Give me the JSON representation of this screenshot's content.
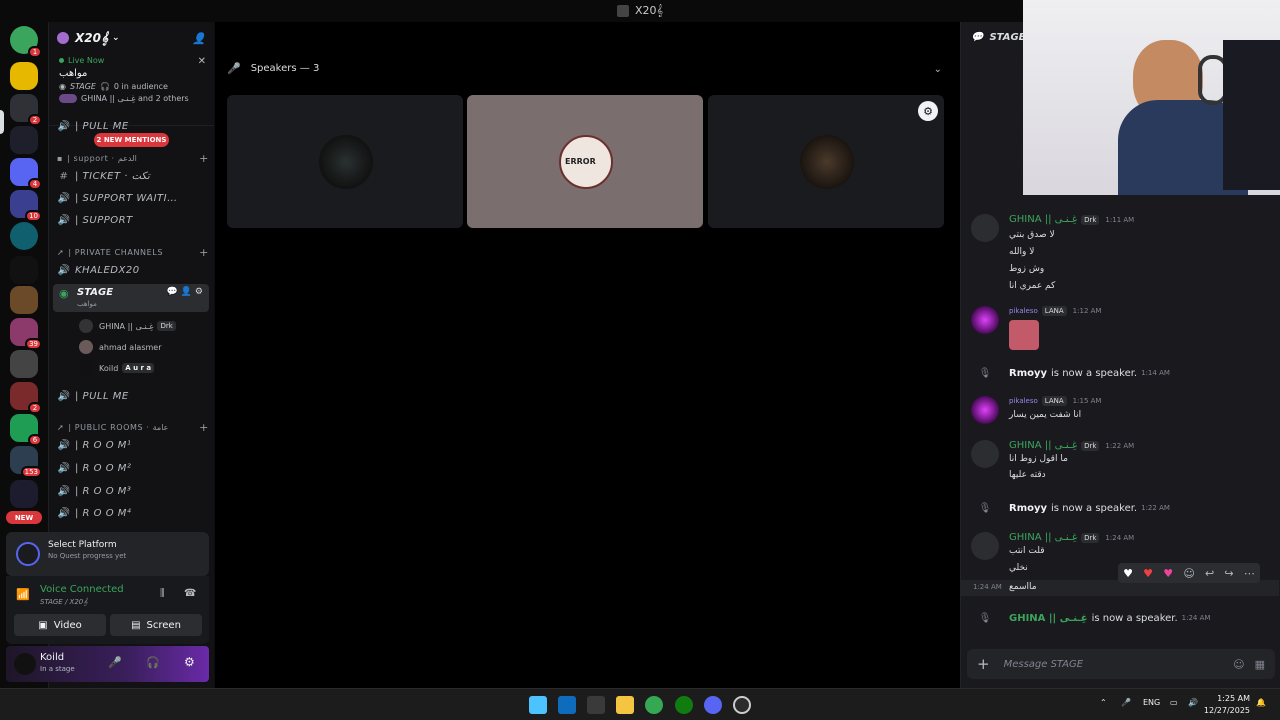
{
  "window": {
    "title": "X20𝄞"
  },
  "colors": {
    "accent": "#5865f2",
    "green": "#3ba55d",
    "red": "#da373c",
    "bg": "#0d0d0e"
  },
  "rail": {
    "badges": [
      "1",
      "2",
      "4",
      "10",
      "39",
      "2",
      "6",
      "153"
    ],
    "new_label": "NEW"
  },
  "guild": {
    "name": "X20𝄞"
  },
  "live": {
    "status": "Live Now",
    "title": "مواهب",
    "stage_label": "STAGE",
    "audience": "0 in audience",
    "speakers": "GHINA || غِـنـى and 2 others"
  },
  "mentions": "2 NEW MENTIONS",
  "channels": {
    "pull_me_top": "| PULL ME",
    "support_cat": "| support · الدعم",
    "ticket": "| TICKET · تكت",
    "support_wait": "| SUPPORT WAITI…",
    "support": "| SUPPORT",
    "private_cat": "| PRIVATE CHANNELS",
    "khaled": "KHALEDX20",
    "stage": "STAGE",
    "stage_sub": "مواهب",
    "members": [
      {
        "name": "GHINA || غِـنـى",
        "tag": "Drk"
      },
      {
        "name": "ahmad alasmer",
        "tag": ""
      },
      {
        "name": "Koild",
        "tag": "A u r a"
      }
    ],
    "pull_me": "| PULL ME",
    "public_cat": "| PUBLIC ROOMS · عامة",
    "rooms": [
      "| R O O M¹",
      "| R O O M²",
      "| R O O M³",
      "| R O O M⁴"
    ]
  },
  "quest": {
    "title": "Select Platform",
    "sub": "No Quest progress yet"
  },
  "voice": {
    "status": "Voice Connected",
    "channel": "STAGE / X20𝄞",
    "video": "Video",
    "screen": "Screen"
  },
  "user": {
    "name": "Koild",
    "status": "In a stage"
  },
  "stage": {
    "speakers_header": "Speakers — 3",
    "tile2_label": "ERROR"
  },
  "chat": {
    "header": "STAGE",
    "m1": {
      "author": "GHINA || غِـنـى",
      "tag": "Drk",
      "time": "1:11 AM",
      "lines": [
        "لا صدق بنتي",
        "لا والله",
        "وش زوط",
        "كم عمري انا"
      ]
    },
    "m2": {
      "author": "pikaleso",
      "tag": "LANA",
      "time": "1:12 AM"
    },
    "s1": {
      "name": "Rmoyy",
      "text": "is now a speaker.",
      "time": "1:14 AM"
    },
    "m3": {
      "author": "pikaleso",
      "tag": "LANA",
      "time": "1:15 AM",
      "line": "انا شفت يمين يسار"
    },
    "m4": {
      "author": "GHINA || غِـنـى",
      "tag": "Drk",
      "time": "1:22 AM",
      "lines": [
        "ما اقول زوط انا",
        "دقته عليها"
      ]
    },
    "s2": {
      "name": "Rmoyy",
      "text": "is now a speaker.",
      "time": "1:22 AM"
    },
    "m5": {
      "author": "GHINA || غِـنـى",
      "tag": "Drk",
      "time": "1:24 AM",
      "lines": [
        "قلت انتب",
        "نخلي"
      ],
      "cont_time": "1:24 AM",
      "cont_line": "مااسمع"
    },
    "s3": {
      "name": "GHINA || غِـنـى",
      "text": "is now a speaker.",
      "time": "1:24 AM"
    },
    "placeholder": "Message STAGE"
  },
  "taskbar": {
    "lang": "ENG",
    "time": "1:25 AM",
    "date": "12/27/2025"
  }
}
